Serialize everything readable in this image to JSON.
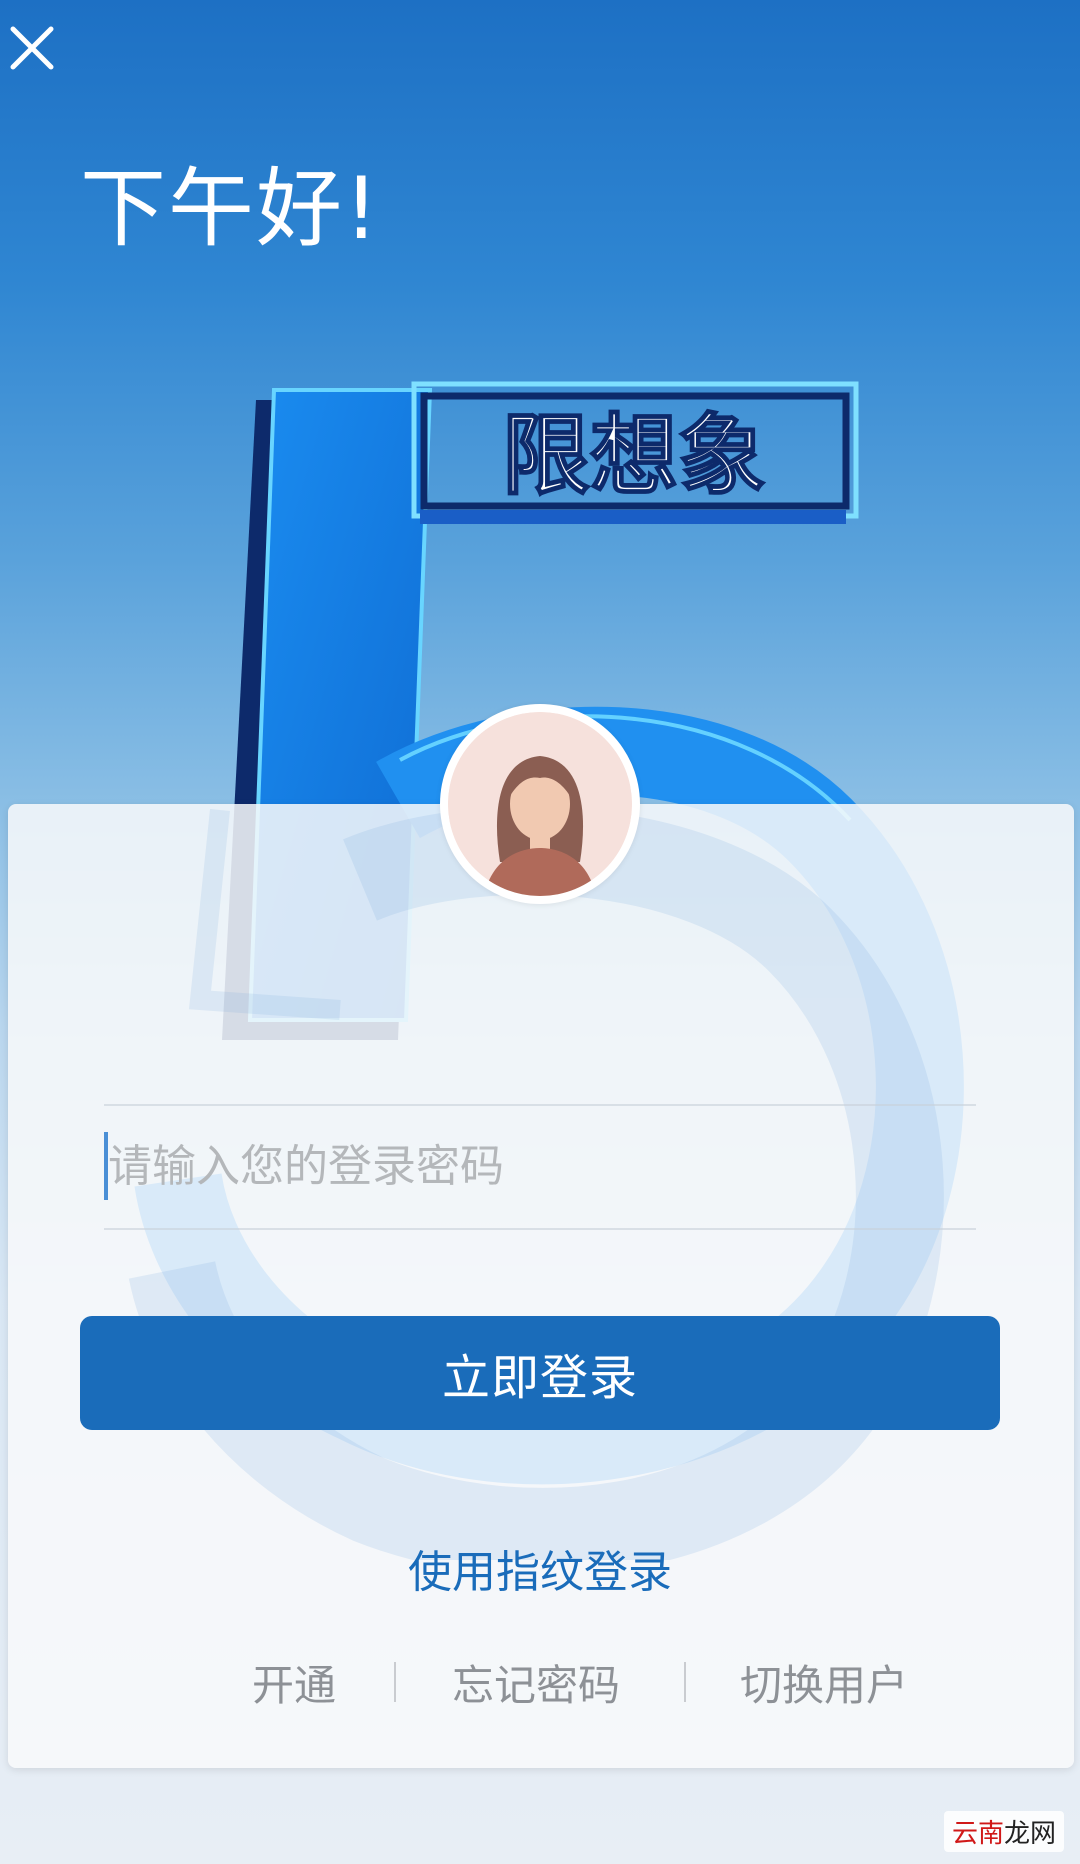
{
  "header": {
    "close_icon": "close-icon",
    "greeting": "下午好!"
  },
  "hero": {
    "badge_text": "限想象"
  },
  "login": {
    "avatar_icon": "user-avatar-female",
    "password_placeholder": "请输入您的登录密码",
    "submit_label": "立即登录",
    "fingerprint_label": "使用指纹登录",
    "links": {
      "open": "开通",
      "forgot": "忘记密码",
      "switch_user": "切换用户"
    }
  },
  "watermark": {
    "accent": "云南",
    "text": "龙网"
  },
  "colors": {
    "primary": "#1a6cba",
    "gradient_top": "#1d70c4",
    "gradient_bottom": "#e8eef5"
  }
}
